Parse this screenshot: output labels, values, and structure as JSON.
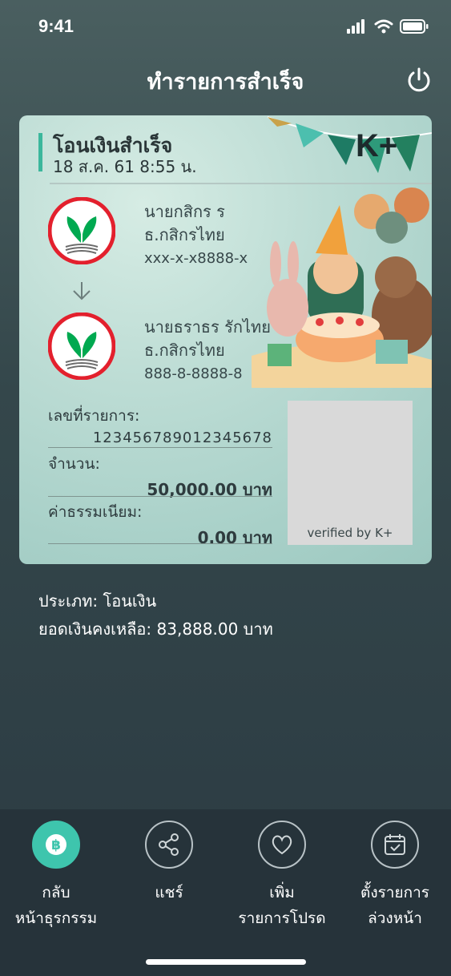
{
  "status": {
    "time": "9:41"
  },
  "header": {
    "title": "ทำรายการสำเร็จ"
  },
  "slip": {
    "title": "โอนเงินสำเร็จ",
    "date": "18 ส.ค. 61  8:55 น.",
    "brand_logo": "K+",
    "sender": {
      "name": "นายกสิกร ร",
      "bank": "ธ.กสิกรไทย",
      "account": "xxx-x-x8888-x"
    },
    "receiver": {
      "name": "นายธราธร รักไทย",
      "bank": "ธ.กสิกรไทย",
      "account": "888-8-8888-8"
    },
    "ref_label": "เลขที่รายการ:",
    "ref_value": "123456789012345678",
    "amount_label": "จำนวน:",
    "amount_value": "50,000.00 บาท",
    "fee_label": "ค่าธรรมเนียม:",
    "fee_value": "0.00 บาท",
    "qr_caption": "verified by K+"
  },
  "info": {
    "type": "ประเภท: โอนเงิน",
    "balance": "ยอดเงินคงเหลือ: 83,888.00 บาท"
  },
  "nav": {
    "home": {
      "line1": "กลับ",
      "line2": "หน้าธุรกรรม",
      "icon": "baht-icon"
    },
    "share": {
      "line1": "แชร์",
      "icon": "share-icon"
    },
    "favorite": {
      "line1": "เพิ่ม",
      "line2": "รายการโปรด",
      "icon": "heart-icon"
    },
    "schedule": {
      "line1": "ตั้งรายการ",
      "line2": "ล่วงหน้า",
      "icon": "calendar-icon"
    }
  },
  "colors": {
    "accent": "#3ec5ad",
    "brand_green": "#00a950",
    "brand_red": "#e3202d"
  }
}
